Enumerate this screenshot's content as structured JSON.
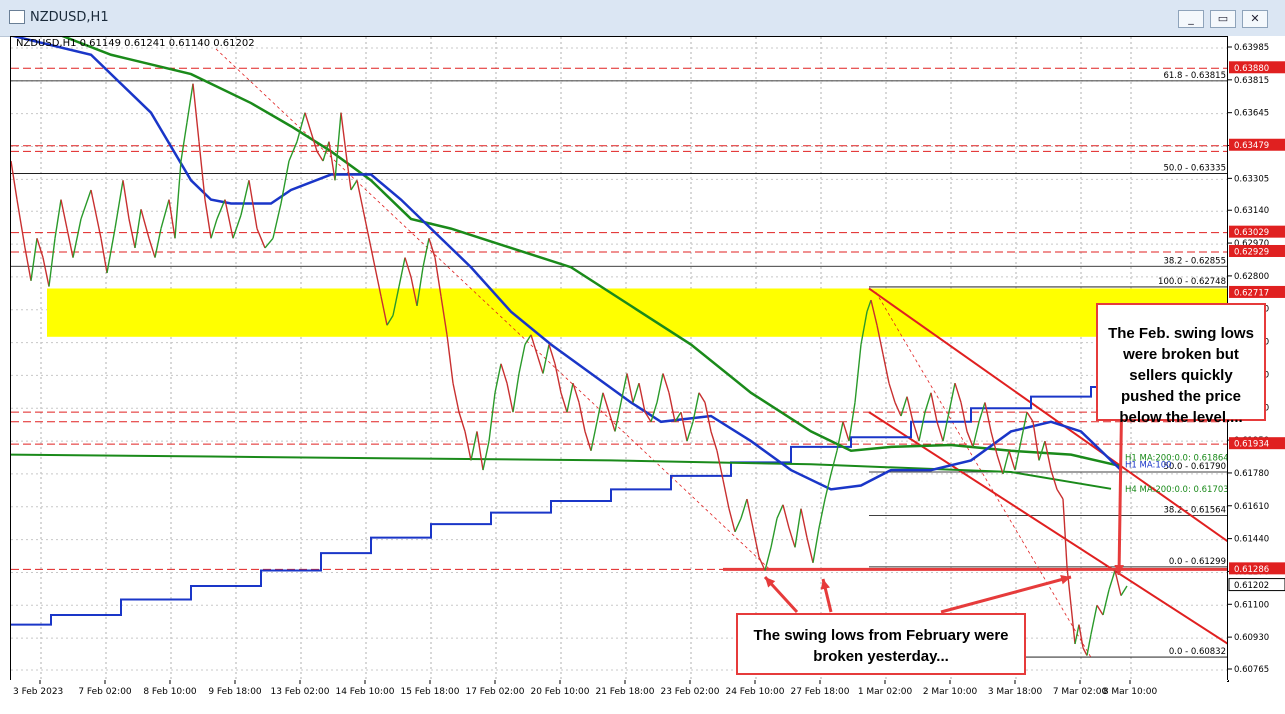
{
  "window": {
    "title": "NZDUSD,H1",
    "buttons": [
      "_",
      "▭",
      "✕"
    ]
  },
  "symbol_line": "NZDUSD,H1  0.61149 0.61241 0.61140 0.61202",
  "callouts": {
    "top_right": [
      "The Feb. swing lows",
      "were broken but",
      "sellers quickly",
      "pushed the price",
      "below the level...."
    ],
    "bottom": [
      "The swing lows from February were",
      "broken yesterday..."
    ]
  },
  "chart_data": {
    "type": "line",
    "symbol": "NZDUSD",
    "timeframe": "H1",
    "ylim": [
      0.60765,
      0.63985
    ],
    "y_ticks": [
      "0.63985",
      "0.63815",
      "0.63645",
      "0.63475",
      "0.63305",
      "0.63140",
      "0.62970",
      "0.62800",
      "0.62630",
      "0.62460",
      "0.62290",
      "0.62120",
      "0.61950",
      "0.61780",
      "0.61610",
      "0.61440",
      "0.61270",
      "0.61100",
      "0.60930",
      "0.60765"
    ],
    "x_ticks": [
      "3 Feb 2023",
      "7 Feb 02:00",
      "8 Feb 10:00",
      "9 Feb 18:00",
      "13 Feb 02:00",
      "14 Feb 10:00",
      "15 Feb 18:00",
      "17 Feb 02:00",
      "20 Feb 10:00",
      "21 Feb 18:00",
      "23 Feb 02:00",
      "24 Feb 10:00",
      "27 Feb 18:00",
      "1 Mar 02:00",
      "2 Mar 10:00",
      "3 Mar 18:00",
      "7 Mar 02:00",
      "8 Mar 10:00"
    ],
    "price_tags": [
      {
        "label": "0.63880",
        "value": 0.6388
      },
      {
        "label": "0.63479",
        "value": 0.63479
      },
      {
        "label": "0.63029",
        "value": 0.63029
      },
      {
        "label": "0.62929",
        "value": 0.62929
      },
      {
        "label": "0.62717",
        "value": 0.62717
      },
      {
        "label": "0.61934",
        "value": 0.61934
      },
      {
        "label": "0.61286",
        "value": 0.61286
      },
      {
        "label": "0.61202",
        "value": 0.61202,
        "current": true
      }
    ],
    "fib_labels": [
      {
        "label": "61.8 - 0.63815",
        "value": 0.63815
      },
      {
        "label": "50.0 - 0.63335",
        "value": 0.63335
      },
      {
        "label": "38.2 - 0.62855",
        "value": 0.62855
      },
      {
        "label": "100.0 - 0.62748",
        "value": 0.62748
      },
      {
        "label": "50.0 - 0.61790",
        "value": 0.6179
      },
      {
        "label": "38.2 - 0.61564",
        "value": 0.61564
      },
      {
        "label": "0.0 - 0.61299",
        "value": 0.61299
      },
      {
        "label": "0.0 - 0.60832",
        "value": 0.60832
      }
    ],
    "ma_labels": [
      {
        "label": "H1 MA:200:0.0: 0.61864",
        "value": 0.61864,
        "color": "#1a8a1a"
      },
      {
        "label": "H1 MA:100",
        "value": 0.6183,
        "color": "#1a36c8"
      },
      {
        "label": "H4 MA:200:0.0: 0.61703",
        "value": 0.61703,
        "color": "#1a8a1a"
      }
    ],
    "horizontal_dashed": [
      0.6388,
      0.63479,
      0.6345,
      0.63029,
      0.62929,
      0.621,
      0.6205,
      0.61934,
      0.61286
    ],
    "yellow_zone": [
      0.6249,
      0.6274
    ],
    "series": {
      "price": [
        [
          0,
          0.634
        ],
        [
          6,
          0.632
        ],
        [
          14,
          0.6295
        ],
        [
          20,
          0.6278
        ],
        [
          26,
          0.63
        ],
        [
          32,
          0.629
        ],
        [
          38,
          0.6275
        ],
        [
          44,
          0.63
        ],
        [
          50,
          0.632
        ],
        [
          56,
          0.6305
        ],
        [
          62,
          0.629
        ],
        [
          70,
          0.631
        ],
        [
          80,
          0.6325
        ],
        [
          90,
          0.63
        ],
        [
          96,
          0.6282
        ],
        [
          104,
          0.6305
        ],
        [
          112,
          0.633
        ],
        [
          118,
          0.631
        ],
        [
          124,
          0.6295
        ],
        [
          130,
          0.6315
        ],
        [
          138,
          0.63
        ],
        [
          144,
          0.629
        ],
        [
          150,
          0.6305
        ],
        [
          158,
          0.632
        ],
        [
          164,
          0.63
        ],
        [
          170,
          0.634
        ],
        [
          176,
          0.636
        ],
        [
          182,
          0.638
        ],
        [
          188,
          0.635
        ],
        [
          194,
          0.632
        ],
        [
          200,
          0.63
        ],
        [
          206,
          0.631
        ],
        [
          214,
          0.632
        ],
        [
          222,
          0.63
        ],
        [
          230,
          0.6312
        ],
        [
          238,
          0.633
        ],
        [
          246,
          0.6305
        ],
        [
          254,
          0.6295
        ],
        [
          262,
          0.63
        ],
        [
          270,
          0.6318
        ],
        [
          278,
          0.634
        ],
        [
          286,
          0.635
        ],
        [
          294,
          0.6365
        ],
        [
          300,
          0.6355
        ],
        [
          306,
          0.6345
        ],
        [
          312,
          0.634
        ],
        [
          318,
          0.635
        ],
        [
          324,
          0.633
        ],
        [
          330,
          0.6365
        ],
        [
          336,
          0.634
        ],
        [
          340,
          0.6325
        ],
        [
          346,
          0.633
        ],
        [
          352,
          0.6315
        ],
        [
          358,
          0.63
        ],
        [
          364,
          0.6285
        ],
        [
          370,
          0.627
        ],
        [
          376,
          0.6255
        ],
        [
          382,
          0.626
        ],
        [
          388,
          0.6275
        ],
        [
          394,
          0.629
        ],
        [
          400,
          0.628
        ],
        [
          406,
          0.6265
        ],
        [
          412,
          0.6285
        ],
        [
          418,
          0.63
        ],
        [
          424,
          0.629
        ],
        [
          430,
          0.627
        ],
        [
          436,
          0.625
        ],
        [
          442,
          0.6225
        ],
        [
          448,
          0.621
        ],
        [
          454,
          0.62
        ],
        [
          460,
          0.6185
        ],
        [
          466,
          0.62
        ],
        [
          472,
          0.618
        ],
        [
          478,
          0.6195
        ],
        [
          484,
          0.622
        ],
        [
          490,
          0.6235
        ],
        [
          496,
          0.6225
        ],
        [
          502,
          0.621
        ],
        [
          508,
          0.623
        ],
        [
          514,
          0.6245
        ],
        [
          520,
          0.625
        ],
        [
          526,
          0.624
        ],
        [
          532,
          0.623
        ],
        [
          538,
          0.6245
        ],
        [
          544,
          0.6235
        ],
        [
          550,
          0.622
        ],
        [
          556,
          0.621
        ],
        [
          562,
          0.6225
        ],
        [
          568,
          0.6215
        ],
        [
          574,
          0.62
        ],
        [
          580,
          0.619
        ],
        [
          586,
          0.6205
        ],
        [
          592,
          0.622
        ],
        [
          598,
          0.621
        ],
        [
          604,
          0.62
        ],
        [
          610,
          0.6215
        ],
        [
          616,
          0.623
        ],
        [
          622,
          0.6215
        ],
        [
          628,
          0.6225
        ],
        [
          634,
          0.621
        ],
        [
          640,
          0.6205
        ],
        [
          646,
          0.6215
        ],
        [
          652,
          0.623
        ],
        [
          658,
          0.622
        ],
        [
          664,
          0.6205
        ],
        [
          670,
          0.621
        ],
        [
          676,
          0.6195
        ],
        [
          682,
          0.6205
        ],
        [
          688,
          0.622
        ],
        [
          694,
          0.6215
        ],
        [
          700,
          0.62
        ],
        [
          706,
          0.619
        ],
        [
          712,
          0.6175
        ],
        [
          718,
          0.616
        ],
        [
          724,
          0.6148
        ],
        [
          730,
          0.6155
        ],
        [
          736,
          0.6165
        ],
        [
          742,
          0.615
        ],
        [
          748,
          0.6135
        ],
        [
          754,
          0.6128
        ],
        [
          760,
          0.614
        ],
        [
          766,
          0.6155
        ],
        [
          772,
          0.6162
        ],
        [
          778,
          0.615
        ],
        [
          784,
          0.614
        ],
        [
          790,
          0.616
        ],
        [
          796,
          0.6145
        ],
        [
          802,
          0.6132
        ],
        [
          808,
          0.615
        ],
        [
          814,
          0.6165
        ],
        [
          820,
          0.6178
        ],
        [
          826,
          0.619
        ],
        [
          832,
          0.6205
        ],
        [
          838,
          0.6195
        ],
        [
          844,
          0.6215
        ],
        [
          850,
          0.6245
        ],
        [
          856,
          0.6262
        ],
        [
          860,
          0.6268
        ],
        [
          866,
          0.6255
        ],
        [
          872,
          0.624
        ],
        [
          878,
          0.6225
        ],
        [
          884,
          0.6215
        ],
        [
          890,
          0.6208
        ],
        [
          896,
          0.6218
        ],
        [
          902,
          0.6205
        ],
        [
          908,
          0.6195
        ],
        [
          914,
          0.621
        ],
        [
          920,
          0.622
        ],
        [
          926,
          0.6205
        ],
        [
          932,
          0.6195
        ],
        [
          938,
          0.621
        ],
        [
          944,
          0.6225
        ],
        [
          950,
          0.6215
        ],
        [
          956,
          0.62
        ],
        [
          962,
          0.6192
        ],
        [
          968,
          0.6205
        ],
        [
          974,
          0.6215
        ],
        [
          980,
          0.62
        ],
        [
          986,
          0.6188
        ],
        [
          992,
          0.6178
        ],
        [
          998,
          0.619
        ],
        [
          1004,
          0.618
        ],
        [
          1010,
          0.6195
        ],
        [
          1016,
          0.621
        ],
        [
          1022,
          0.6205
        ],
        [
          1028,
          0.6185
        ],
        [
          1034,
          0.6195
        ],
        [
          1040,
          0.618
        ],
        [
          1046,
          0.617
        ],
        [
          1052,
          0.6165
        ],
        [
          1056,
          0.613
        ],
        [
          1060,
          0.611
        ],
        [
          1064,
          0.609
        ],
        [
          1068,
          0.61
        ],
        [
          1072,
          0.6088
        ],
        [
          1076,
          0.6084
        ],
        [
          1080,
          0.6095
        ],
        [
          1086,
          0.611
        ],
        [
          1092,
          0.6105
        ],
        [
          1098,
          0.6118
        ],
        [
          1104,
          0.6128
        ],
        [
          1110,
          0.6115
        ],
        [
          1116,
          0.612
        ]
      ],
      "ma_blue": [
        [
          0,
          0.6405
        ],
        [
          80,
          0.6395
        ],
        [
          140,
          0.6365
        ],
        [
          180,
          0.633
        ],
        [
          200,
          0.632
        ],
        [
          220,
          0.6318
        ],
        [
          260,
          0.6318
        ],
        [
          280,
          0.6325
        ],
        [
          320,
          0.6333
        ],
        [
          360,
          0.6333
        ],
        [
          390,
          0.632
        ],
        [
          420,
          0.6305
        ],
        [
          460,
          0.6285
        ],
        [
          500,
          0.6262
        ],
        [
          540,
          0.6245
        ],
        [
          580,
          0.623
        ],
        [
          620,
          0.6215
        ],
        [
          650,
          0.6205
        ],
        [
          700,
          0.6208
        ],
        [
          740,
          0.6195
        ],
        [
          780,
          0.618
        ],
        [
          820,
          0.617
        ],
        [
          850,
          0.6172
        ],
        [
          880,
          0.618
        ],
        [
          920,
          0.618
        ],
        [
          960,
          0.6185
        ],
        [
          1000,
          0.62
        ],
        [
          1040,
          0.6205
        ],
        [
          1070,
          0.62
        ],
        [
          1110,
          0.618
        ]
      ],
      "ma_green": [
        [
          0,
          0.6415
        ],
        [
          100,
          0.6395
        ],
        [
          180,
          0.6385
        ],
        [
          240,
          0.637
        ],
        [
          280,
          0.6358
        ],
        [
          320,
          0.6345
        ],
        [
          360,
          0.633
        ],
        [
          400,
          0.631
        ],
        [
          440,
          0.6305
        ],
        [
          500,
          0.6295
        ],
        [
          560,
          0.6285
        ],
        [
          620,
          0.6265
        ],
        [
          680,
          0.6245
        ],
        [
          740,
          0.622
        ],
        [
          800,
          0.62
        ],
        [
          840,
          0.619
        ],
        [
          880,
          0.6192
        ],
        [
          940,
          0.6193
        ],
        [
          1000,
          0.619
        ],
        [
          1060,
          0.6188
        ],
        [
          1110,
          0.6182
        ]
      ],
      "h4_ma_green": [
        [
          0,
          0.6188
        ],
        [
          200,
          0.6187
        ],
        [
          400,
          0.6186
        ],
        [
          600,
          0.6185
        ],
        [
          800,
          0.6183
        ],
        [
          1000,
          0.6179
        ],
        [
          1100,
          0.61703
        ]
      ],
      "h4_ma_blue_steps": [
        [
          0,
          0.61
        ],
        [
          40,
          0.6105
        ],
        [
          110,
          0.6113
        ],
        [
          180,
          0.612
        ],
        [
          250,
          0.6128
        ],
        [
          310,
          0.6137
        ],
        [
          360,
          0.6145
        ],
        [
          420,
          0.6152
        ],
        [
          480,
          0.6158
        ],
        [
          540,
          0.6164
        ],
        [
          600,
          0.617
        ],
        [
          660,
          0.6177
        ],
        [
          720,
          0.6184
        ],
        [
          780,
          0.6192
        ],
        [
          840,
          0.6197
        ],
        [
          900,
          0.6205
        ],
        [
          960,
          0.6212
        ],
        [
          1020,
          0.6218
        ],
        [
          1080,
          0.6223
        ],
        [
          1110,
          0.6228
        ]
      ]
    }
  }
}
